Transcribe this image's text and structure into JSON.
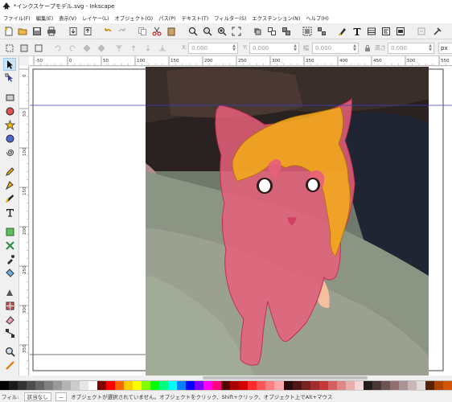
{
  "window": {
    "title": "*インクスケープモデル.svg - Inkscape"
  },
  "menu": [
    "ファイル(F)",
    "編集(E)",
    "表示(V)",
    "レイヤー(L)",
    "オブジェクト(O)",
    "パス(P)",
    "テキスト(T)",
    "フィルター(S)",
    "エクステンション(N)",
    "ヘルプ(H)"
  ],
  "controls": {
    "x_label": "X:",
    "x_value": "0.000",
    "y_label": "Y:",
    "y_value": "0.000",
    "w_label": "幅",
    "w_value": "0.000",
    "h_label": "高さ",
    "h_value": "0.000",
    "unit": "px"
  },
  "ruler": {
    "h_ticks": [
      "-50",
      "0",
      "50",
      "100",
      "150",
      "200",
      "250",
      "300",
      "350",
      "400",
      "450",
      "500",
      "550"
    ],
    "v_ticks": [
      "0",
      "50",
      "100",
      "150",
      "200",
      "250",
      "300",
      "350"
    ]
  },
  "status": {
    "fill_label": "フィル:",
    "fill_value": "該当なし",
    "stroke_value": "—",
    "message": "オブジェクトが選択されていません。オブジェクトをクリック、Shift+クリック、オブジェクト上でAlt+マウス"
  },
  "colors": {
    "accent": "#3c3cc8",
    "cat_fill": "#e8607a",
    "patch_fill": "#f2a81e"
  },
  "palette": [
    "#000000",
    "#1a1a1a",
    "#333333",
    "#4d4d4d",
    "#666666",
    "#808080",
    "#999999",
    "#b3b3b3",
    "#cccccc",
    "#e6e6e6",
    "#ffffff",
    "#800000",
    "#ff0000",
    "#ff6600",
    "#ffcc00",
    "#ffff00",
    "#80ff00",
    "#00ff00",
    "#00ff80",
    "#00ffff",
    "#0080ff",
    "#0000ff",
    "#8000ff",
    "#ff00ff",
    "#ff0080",
    "#550000",
    "#aa0000",
    "#d40000",
    "#ff2a2a",
    "#ff5555",
    "#ff8080",
    "#ffaaaa",
    "#280b0b",
    "#501616",
    "#782121",
    "#a02c2c",
    "#c83737",
    "#d35f5f",
    "#de8787",
    "#e9afaf",
    "#f4d7d7",
    "#241c1c",
    "#483737",
    "#6c5353",
    "#916f6f",
    "#ac9393",
    "#c8b7b7",
    "#e3dbdb",
    "#552200",
    "#aa4400",
    "#d45500"
  ]
}
